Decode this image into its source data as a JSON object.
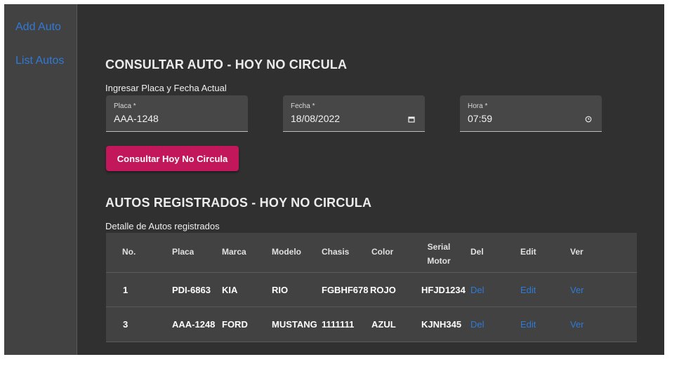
{
  "sidebar": {
    "links": [
      "Add Auto",
      "List Autos"
    ]
  },
  "consulta": {
    "title": "CONSULTAR AUTO - HOY NO CIRCULA",
    "subtitle": "Ingresar Placa y Fecha Actual",
    "placa": {
      "label": "Placa *",
      "value": "AAA-1248"
    },
    "fecha": {
      "label": "Fecha *",
      "value": "18/08/2022",
      "icon": "calendar-icon"
    },
    "hora": {
      "label": "Hora *",
      "value": "07:59",
      "icon": "clock-icon"
    },
    "button": "Consultar Hoy No Circula"
  },
  "registrados": {
    "title": "AUTOS REGISTRADOS - HOY NO CIRCULA",
    "subtitle": "Detalle de Autos registrados",
    "headers": [
      "No.",
      "Placa",
      "Marca",
      "Modelo",
      "Chasis",
      "Color",
      "Serial",
      "Motor",
      "Del",
      "Edit",
      "Ver"
    ],
    "rows": [
      {
        "no": "1",
        "placa": "PDI-6863",
        "marca": "KIA",
        "modelo": "RIO",
        "chasis": "FGBHF678",
        "color": "ROJO",
        "serial": "HFJD1234",
        "del": "Del",
        "edit": "Edit",
        "ver": "Ver"
      },
      {
        "no": "3",
        "placa": "AAA-1248",
        "marca": "FORD",
        "modelo": "MUSTANG",
        "chasis": "1111111",
        "color": "AZUL",
        "serial": "KJNH345",
        "del": "Del",
        "edit": "Edit",
        "ver": "Ver"
      }
    ]
  },
  "colors": {
    "accent": "#c2185b",
    "link": "#2f7ad6",
    "background": "#303030",
    "surface": "#424242"
  }
}
